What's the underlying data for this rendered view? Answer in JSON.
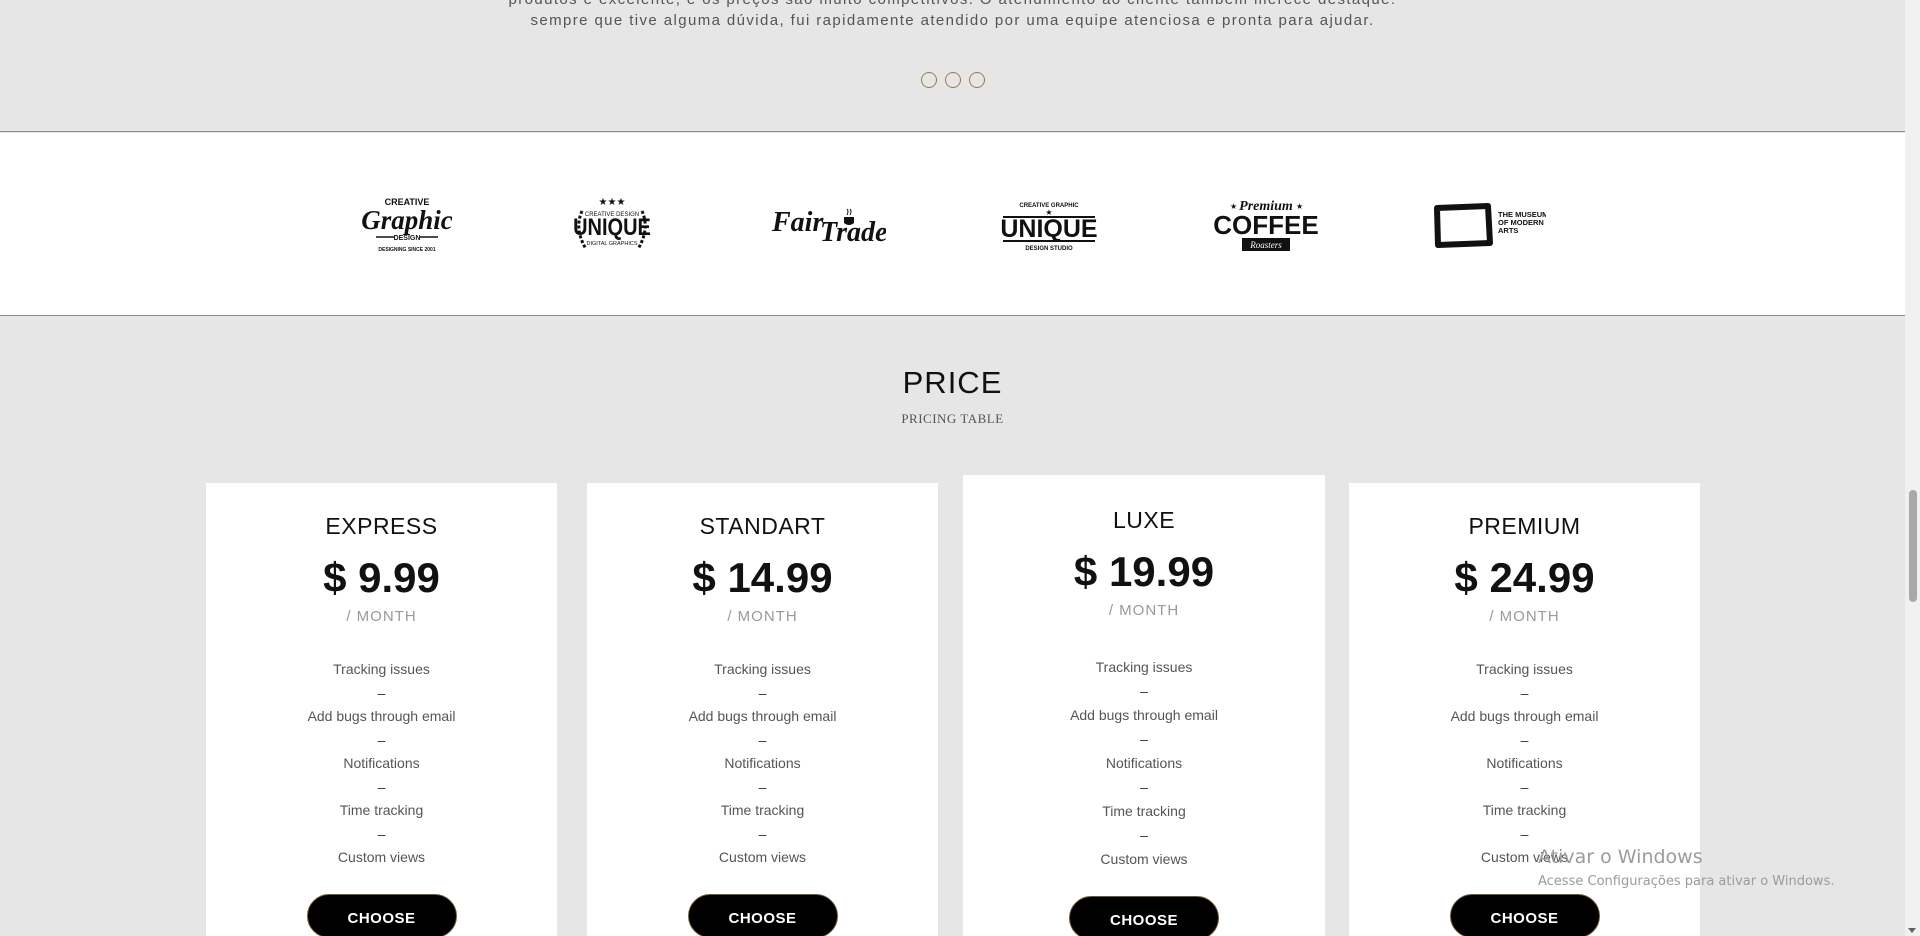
{
  "testimonial": {
    "line1": "produtos é excelente, e os preços são muito competitivos. O atendimento ao cliente também merece destaque:",
    "line2": "sempre que tive alguma dúvida, fui rapidamente atendido por uma equipe atenciosa e pronta para ajudar.",
    "dots": 3
  },
  "logos": {
    "items": [
      {
        "name": "creative-graphic",
        "top": "CREATIVE",
        "main": "Graphic",
        "sub": "DESIGN",
        "foot": "DESIGNING SINCE 2001"
      },
      {
        "name": "unique-laurel",
        "top": "CREATIVE DESIGN",
        "main": "UNIQUE",
        "sub": "DIGITAL GRAPHICS"
      },
      {
        "name": "fair-trade",
        "main1": "Fair",
        "main2": "Trade"
      },
      {
        "name": "unique-studio",
        "top": "CREATIVE GRAPHIC",
        "main": "UNIQUE",
        "sub": "DESIGN STUDIO"
      },
      {
        "name": "premium-coffee",
        "top": "Premium",
        "main": "COFFEE",
        "sub": "Roasters"
      },
      {
        "name": "museum-modern-arts",
        "main": "THE MUSEUM OF MODERN ARTS"
      }
    ]
  },
  "pricing": {
    "title": "PRICE",
    "subtitle": "PRICING TABLE",
    "button_label": "CHOOSE",
    "period": "/ MONTH",
    "dash": "–",
    "features": [
      "Tracking issues",
      "Add bugs through email",
      "Notifications",
      "Time tracking",
      "Custom views"
    ],
    "plans": [
      {
        "name": "EXPRESS",
        "price": "$ 9.99"
      },
      {
        "name": "STANDART",
        "price": "$ 14.99"
      },
      {
        "name": "LUXE",
        "price": "$ 19.99"
      },
      {
        "name": "PREMIUM",
        "price": "$ 24.99"
      }
    ]
  },
  "watermark": {
    "title": "Ativar o Windows",
    "subtitle": "Acesse Configurações para ativar o Windows."
  }
}
